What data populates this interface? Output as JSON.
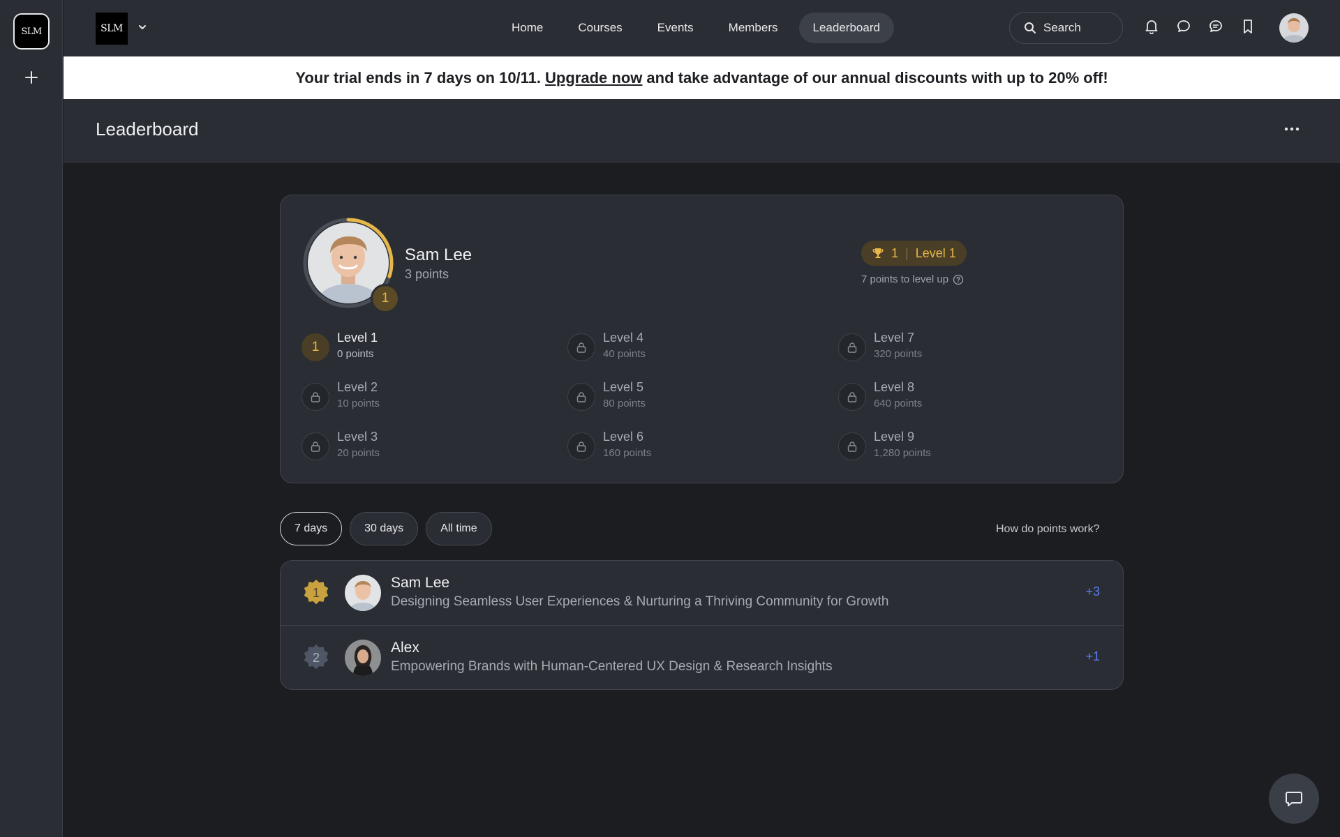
{
  "app": {
    "rail_logo_text": "SLM",
    "brand_text": "SLM"
  },
  "nav": {
    "items": [
      {
        "label": "Home"
      },
      {
        "label": "Courses"
      },
      {
        "label": "Events"
      },
      {
        "label": "Members"
      },
      {
        "label": "Leaderboard",
        "active": true
      }
    ]
  },
  "search": {
    "label": "Search"
  },
  "icons": {
    "rail_add": "plus-icon",
    "brand_caret": "chevron-down-icon",
    "search": "search-icon",
    "notifications": "bell-icon",
    "messages": "chat-bubble-icon",
    "chat": "chat-dots-icon",
    "bookmarks": "bookmark-icon",
    "more": "more-horizontal-icon",
    "trophy": "trophy-icon",
    "lock": "lock-icon",
    "help": "question-circle-icon",
    "fab": "chat-icon"
  },
  "banner": {
    "before": "Your trial ends in 7 days on 10/11.",
    "link": "Upgrade now",
    "after": "and take advantage of our annual discounts with up to 20% off!"
  },
  "page": {
    "title": "Leaderboard"
  },
  "profile": {
    "name": "Sam Lee",
    "points": "3 points",
    "rank": "1",
    "pill_rank": "1",
    "pill_level": "Level 1",
    "hint": "7 points to level up",
    "level_progress": 0.3
  },
  "levels": [
    {
      "name": "Level 1",
      "points": "0 points",
      "badge": "1",
      "current": true
    },
    {
      "name": "Level 2",
      "points": "10 points"
    },
    {
      "name": "Level 3",
      "points": "20 points"
    },
    {
      "name": "Level 4",
      "points": "40 points"
    },
    {
      "name": "Level 5",
      "points": "80 points"
    },
    {
      "name": "Level 6",
      "points": "160 points"
    },
    {
      "name": "Level 7",
      "points": "320 points"
    },
    {
      "name": "Level 8",
      "points": "640 points"
    },
    {
      "name": "Level 9",
      "points": "1,280 points"
    }
  ],
  "filters": {
    "items": [
      {
        "label": "7 days",
        "active": true
      },
      {
        "label": "30 days"
      },
      {
        "label": "All time"
      }
    ],
    "how_label": "How do points work?"
  },
  "leaderboard": [
    {
      "rank": "1",
      "name": "Sam Lee",
      "bio": "Designing Seamless User Experiences & Nurturing a Thriving Community for Growth",
      "delta": "+3"
    },
    {
      "rank": "2",
      "name": "Alex",
      "bio": "Empowering Brands with Human-Centered UX Design & Research Insights",
      "delta": "+1"
    }
  ],
  "colors": {
    "accent_gold": "#e8b74a",
    "points_blue": "#5b7cf0",
    "silver_badge": "#4f5766"
  }
}
